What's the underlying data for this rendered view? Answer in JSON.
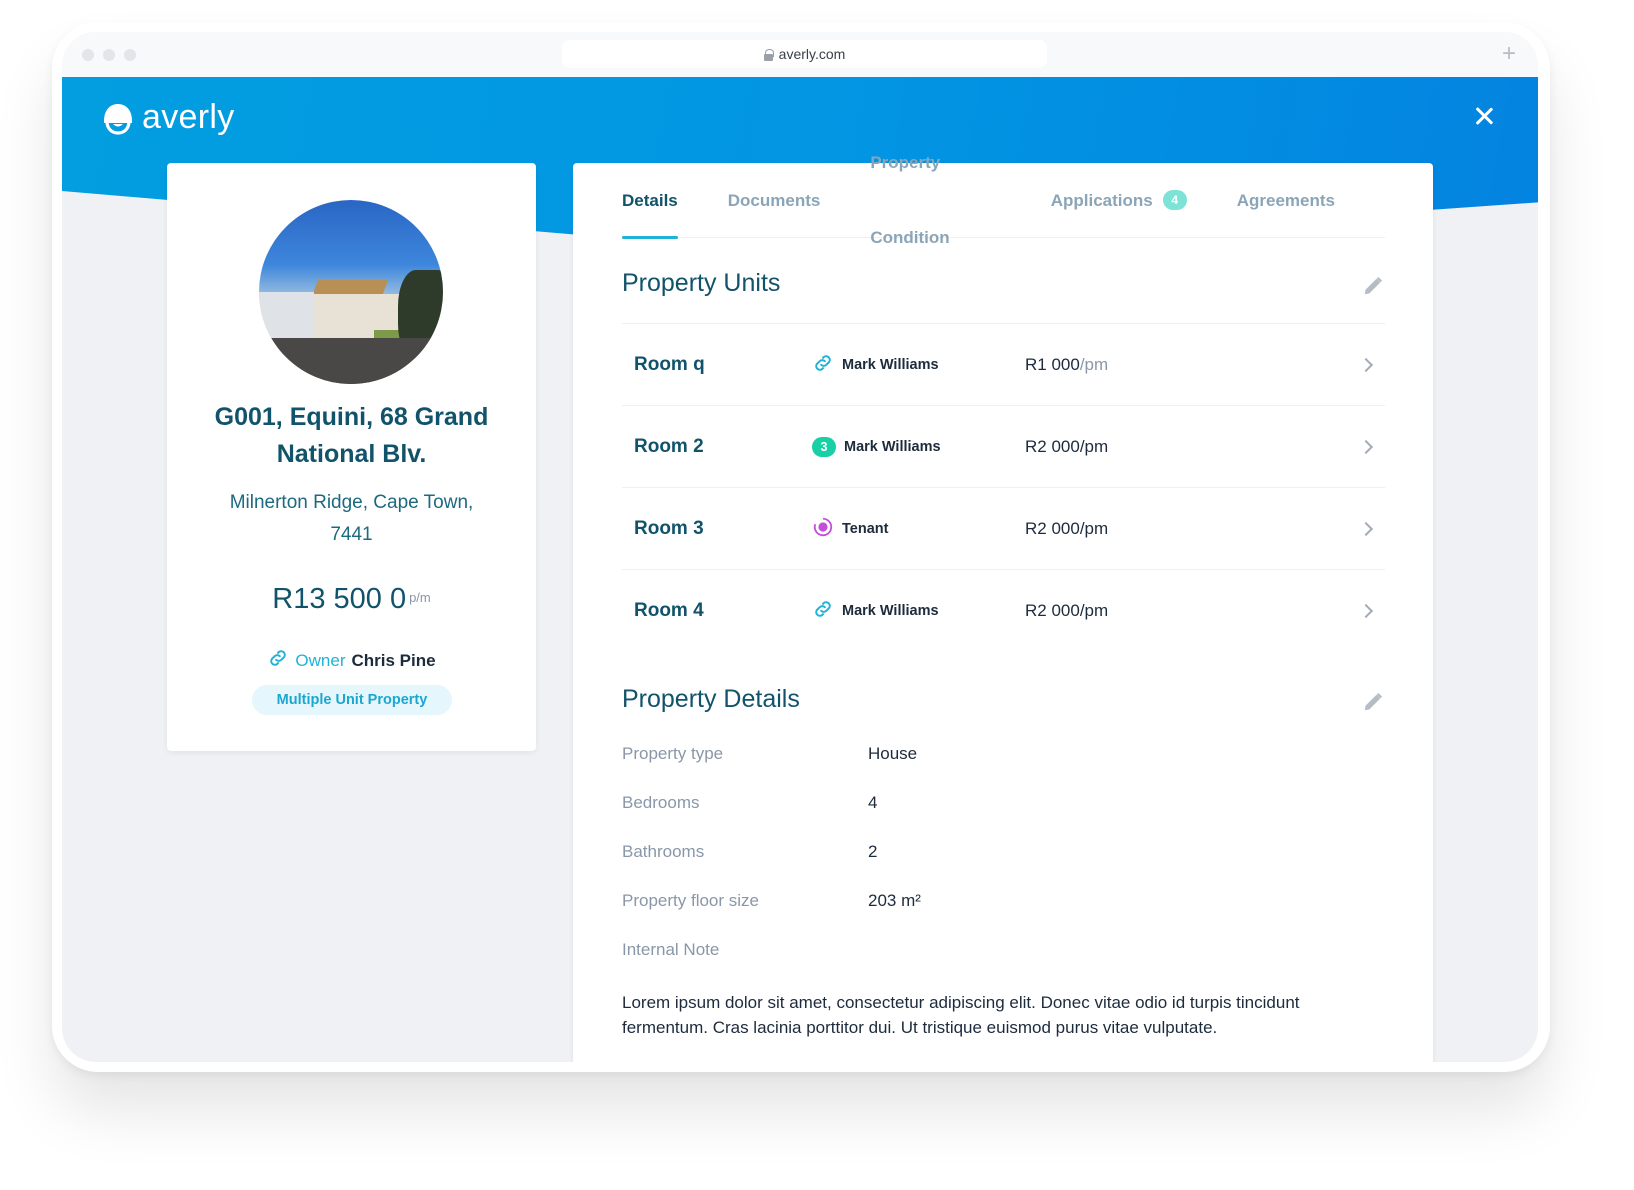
{
  "browser": {
    "url": "averly.com",
    "new_tab_label": "+"
  },
  "header": {
    "brand": "averly",
    "close_label": "close"
  },
  "property": {
    "title": "G001, Equini, 68 Grand National Blv.",
    "location": "Milnerton Ridge, Cape Town, 7441",
    "price": "R13 500 0",
    "price_unit": "p/m",
    "owner_label": "Owner",
    "owner_name": "Chris Pine",
    "type_badge": "Multiple Unit Property"
  },
  "tabs": [
    {
      "label": "Details",
      "active": true
    },
    {
      "label": "Documents"
    },
    {
      "label": "Property Condition"
    },
    {
      "label": "Applications",
      "count": "4"
    },
    {
      "label": "Agreements"
    }
  ],
  "units_section": {
    "title": "Property Units",
    "rows": [
      {
        "name": "Room q",
        "tenant_icon": "link-icon",
        "tenant": "Mark Williams",
        "rent": "R1 000",
        "rent_unit": "/pm"
      },
      {
        "name": "Room 2",
        "tenant_icon": "count-pill",
        "tenant_count": "3",
        "tenant": "Mark Williams",
        "rent": "R2 000",
        "rent_unit": "/pm"
      },
      {
        "name": "Room 3",
        "tenant_icon": "pending-icon",
        "tenant": "Tenant",
        "rent": "R2 000",
        "rent_unit": "/pm"
      },
      {
        "name": "Room 4",
        "tenant_icon": "link-icon",
        "tenant": "Mark Williams",
        "rent": "R2 000",
        "rent_unit": "/pm"
      }
    ]
  },
  "details_section": {
    "title": "Property Details",
    "rows": [
      {
        "label": "Property type",
        "value": "House"
      },
      {
        "label": "Bedrooms",
        "value": "4"
      },
      {
        "label": "Bathrooms",
        "value": "2"
      },
      {
        "label": "Property floor size",
        "value": "203 m²"
      },
      {
        "label": "Internal Note",
        "value": ""
      }
    ],
    "note": "Lorem ipsum dolor sit amet, consectetur adipiscing elit. Donec vitae odio id turpis tincidunt fermentum. Cras lacinia porttitor dui. Ut tristique euismod purus vitae vulputate."
  },
  "colors": {
    "brand_blue": "#029ee0",
    "heading_teal": "#11536b",
    "accent_cyan": "#1fb3d8",
    "pill_green": "#19cfa6",
    "pending_purple": "#c24fd9"
  }
}
